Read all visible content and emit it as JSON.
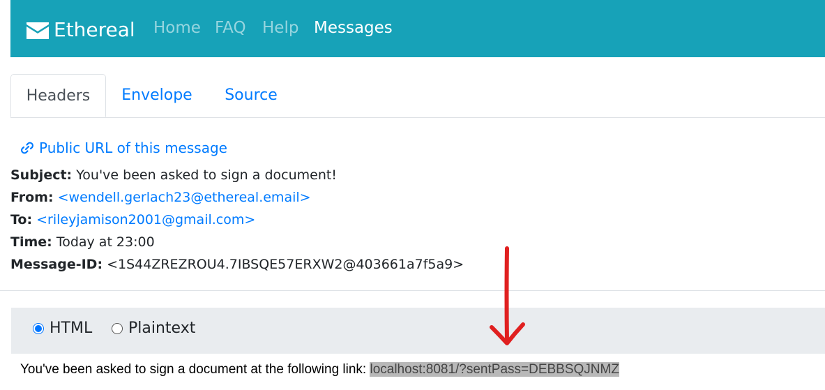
{
  "navbar": {
    "brand": "Ethereal",
    "links": [
      {
        "label": "Home"
      },
      {
        "label": "FAQ"
      },
      {
        "label": "Help"
      },
      {
        "label": "Messages"
      }
    ]
  },
  "tabs": [
    {
      "label": "Headers"
    },
    {
      "label": "Envelope"
    },
    {
      "label": "Source"
    }
  ],
  "public_url_label": "Public URL of this message",
  "headers": {
    "subject": {
      "label": "Subject:",
      "value": "You've been asked to sign a document!"
    },
    "from": {
      "label": "From:",
      "value": "<wendell.gerlach23@ethereal.email>"
    },
    "to": {
      "label": "To:",
      "value": "<rileyjamison2001@gmail.com>"
    },
    "time": {
      "label": "Time:",
      "value": "Today at 23:00"
    },
    "message_id": {
      "label": "Message-ID:",
      "value": "<1S44ZREZROU4.7IBSQE57ERXW2@403661a7f5a9>"
    }
  },
  "format": {
    "options": [
      {
        "label": "HTML",
        "checked": true
      },
      {
        "label": "Plaintext",
        "checked": false
      }
    ]
  },
  "message_body": {
    "text": "You've been asked to sign a document at the following link: ",
    "link": "localhost:8081/?sentPass=DEBBSQJNMZ"
  },
  "colors": {
    "navbar": "#17a2b8",
    "link": "#007bff",
    "annotation": "#e02020"
  },
  "icons": {
    "brand": "envelope-icon",
    "public_url": "link-icon",
    "annotation": "red-arrow-down"
  }
}
